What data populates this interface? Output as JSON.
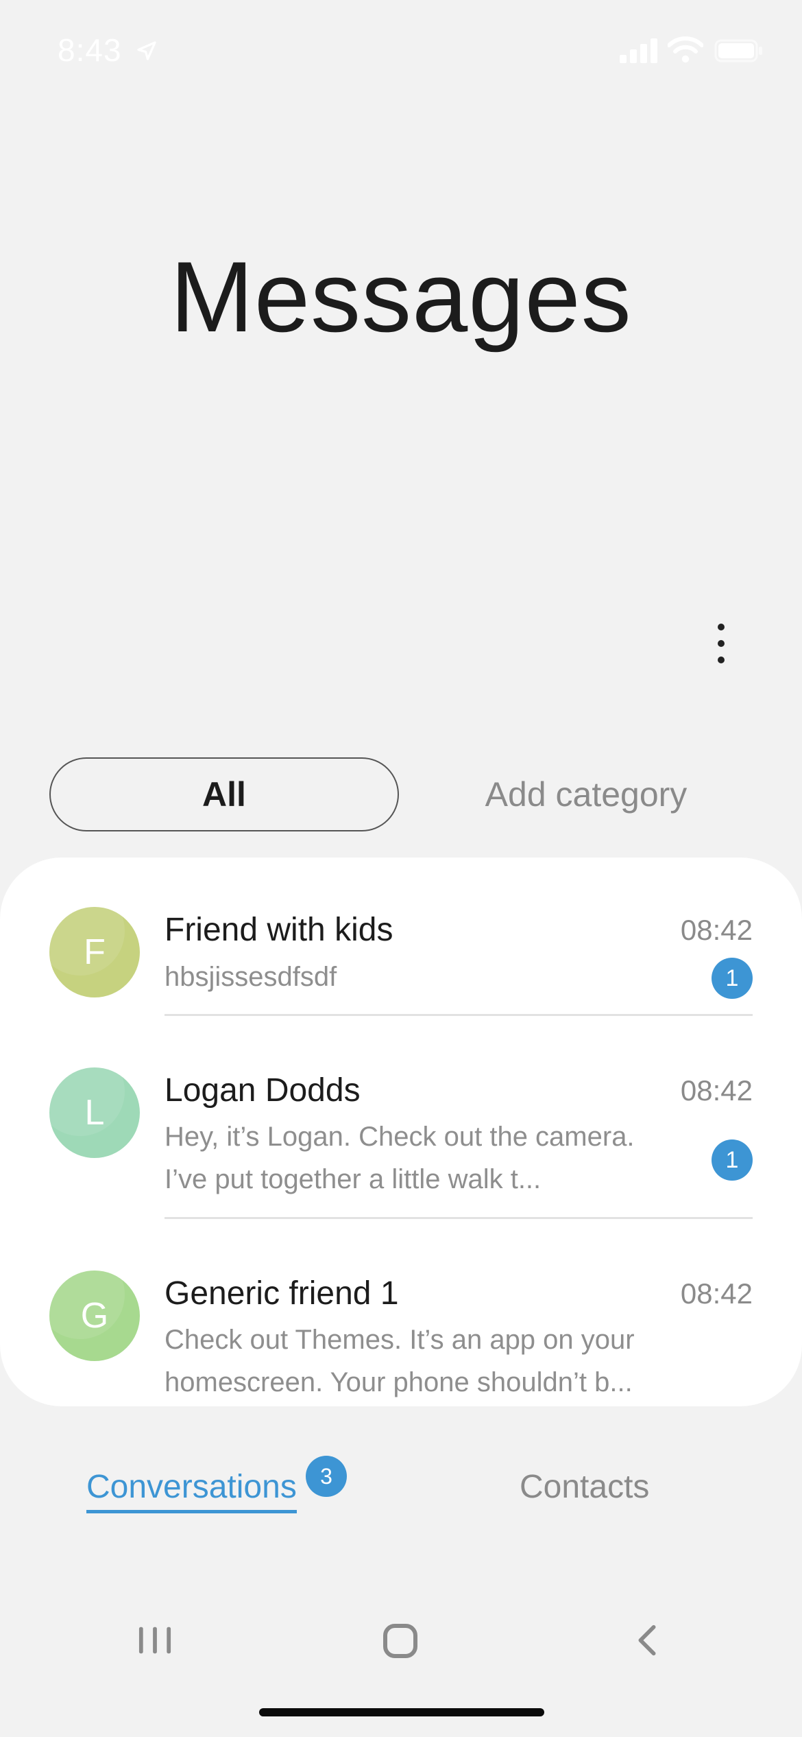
{
  "status_bar": {
    "time": "8:43"
  },
  "header": {
    "title": "Messages"
  },
  "filters": {
    "all_label": "All",
    "add_category_label": "Add category"
  },
  "conversations": [
    {
      "initial": "F",
      "name": "Friend with kids",
      "time": "08:42",
      "preview": [
        "hbsjissesdfsdf"
      ],
      "unread": "1",
      "avatar_color": "#c6d27f"
    },
    {
      "initial": "L",
      "name": "Logan Dodds",
      "time": "08:42",
      "preview": [
        "Hey, it’s Logan. Check out the camera.",
        "I’ve put together a little walk t..."
      ],
      "unread": "1",
      "avatar_color": "#9ed9b7"
    },
    {
      "initial": "G",
      "name": "Generic friend 1",
      "time": "08:42",
      "preview": [
        "Check out Themes. It’s an app on your",
        "homescreen. Your phone shouldn’t b..."
      ],
      "avatar_color": "#a7d98f"
    }
  ],
  "tabs": {
    "conversations_label": "Conversations",
    "conversations_badge": "3",
    "contacts_label": "Contacts"
  },
  "colors": {
    "accent": "#3d95d4",
    "background": "#f2f2f2"
  },
  "icons": {
    "location": "location-arrow-icon",
    "signal": "cellular-signal-icon",
    "wifi": "wifi-icon",
    "battery": "battery-icon",
    "more": "more-vertical-icon",
    "recent_apps": "recent-apps-icon",
    "home": "home-icon",
    "back": "back-icon"
  }
}
